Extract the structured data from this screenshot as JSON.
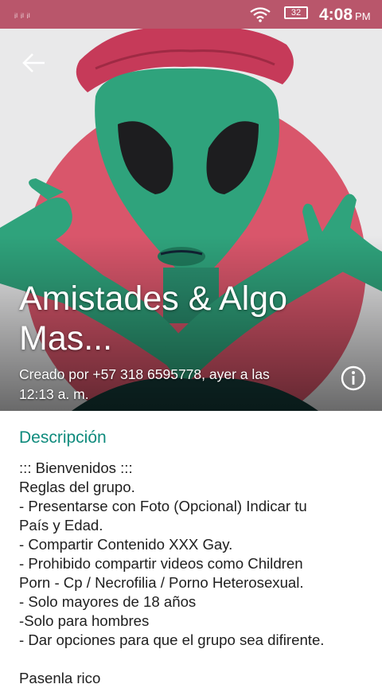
{
  "status_bar": {
    "carrier": "ᵢₗ ᵢₗ ᵢₗ",
    "battery": "32",
    "time": "4:08",
    "ampm": "PM",
    "color": "#b9566b"
  },
  "header": {
    "back_icon": "arrow-back-icon",
    "title_line1": "Amistades & Algo",
    "title_line2": "Mas...",
    "created_line1": "Creado por +57 318 6595778, ayer a las",
    "created_line2": "12:13 a. m.",
    "info_icon": "info-icon"
  },
  "description": {
    "heading": "Descripción",
    "heading_color": "#0f8b7d",
    "lines": [
      "::: Bienvenidos :::",
      "Reglas del grupo.",
      "- Presentarse con Foto (Opcional) Indicar tu",
      "País y Edad.",
      "- Compartir Contenido XXX Gay.",
      "- Prohibido compartir videos como Children",
      "Porn - Cp / Necrofilia / Porno Heterosexual.",
      "- Solo mayores de 18 años",
      "-Solo para hombres",
      "- Dar opciones para que el grupo sea difirente.",
      "",
      "Pasenla rico"
    ]
  }
}
